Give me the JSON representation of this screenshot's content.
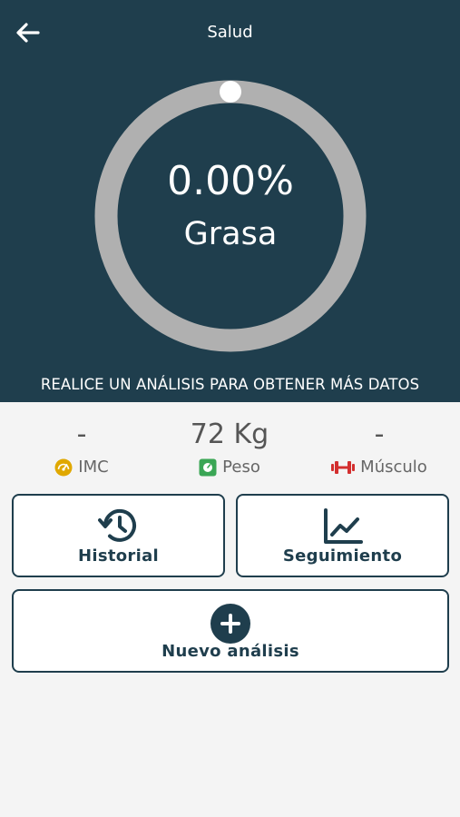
{
  "header": {
    "title": "Salud",
    "background": "#1f3e4d"
  },
  "gauge": {
    "value": "0.00%",
    "label": "Grasa",
    "fraction": 0.0,
    "track_color": "#b0b0b0",
    "knob_color": "#ffffff"
  },
  "notice": "REALICE UN ANÁLISIS PARA OBTENER MÁS DATOS",
  "stats": {
    "imc": {
      "value": "-",
      "label": "IMC",
      "icon": "gauge-icon",
      "color": "#e0a800"
    },
    "peso": {
      "value": "72 Kg",
      "label": "Peso",
      "icon": "scale-icon",
      "color": "#3aa655"
    },
    "musculo": {
      "value": "-",
      "label": "Músculo",
      "icon": "dumbbell-icon",
      "color": "#d32f2f"
    }
  },
  "actions": {
    "historial": {
      "label": "Historial",
      "icon": "history-icon"
    },
    "seguimiento": {
      "label": "Seguimiento",
      "icon": "line-chart-icon"
    },
    "nuevo": {
      "label": "Nuevo análisis",
      "icon": "plus-circle-icon"
    }
  }
}
